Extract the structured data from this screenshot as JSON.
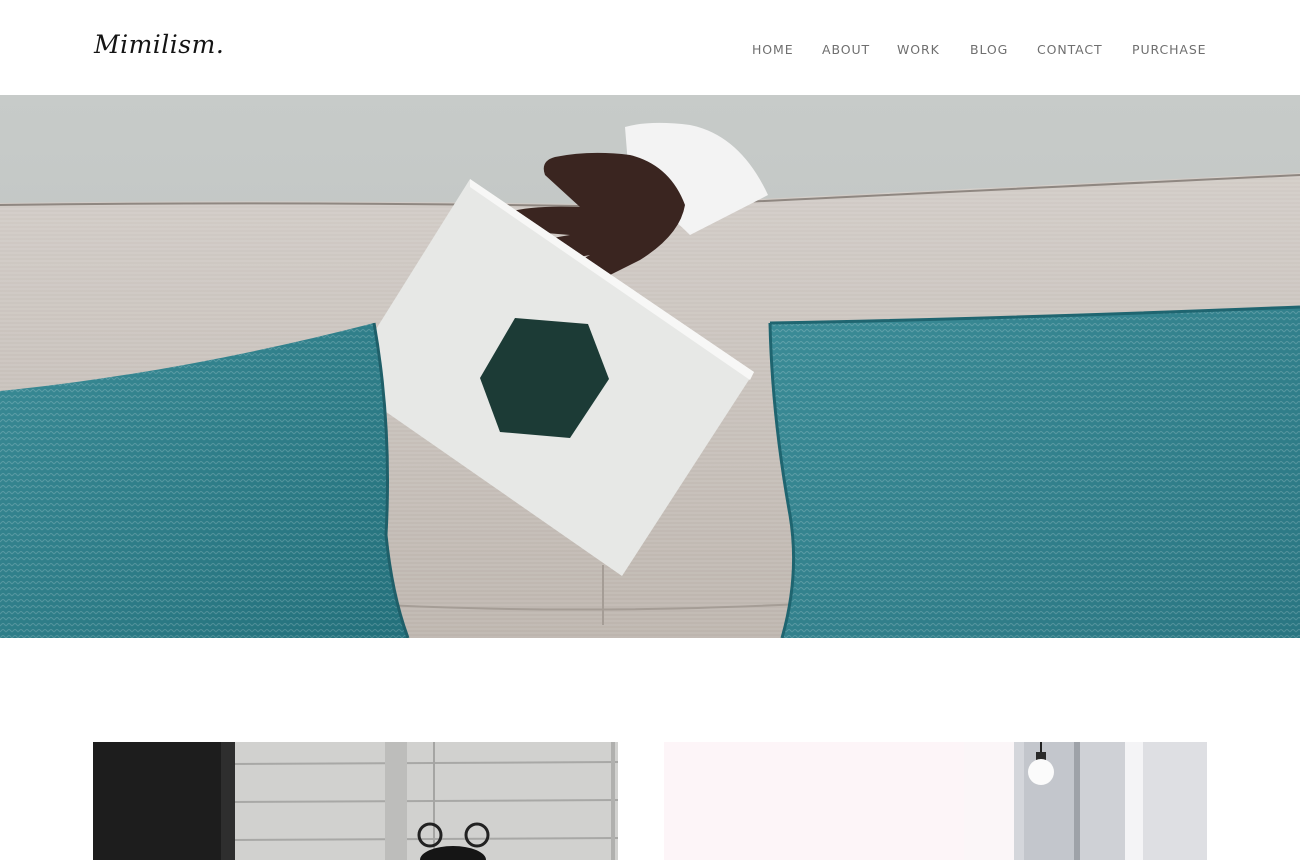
{
  "brand": {
    "logo_text": "Mimilism."
  },
  "nav": {
    "items": [
      {
        "label": "HOME"
      },
      {
        "label": "ABOUT"
      },
      {
        "label": "WORK"
      },
      {
        "label": "BLOG"
      },
      {
        "label": "CONTACT"
      },
      {
        "label": "PURCHASE"
      }
    ]
  },
  "hero": {
    "image": "photo-hand-holding-white-card-with-dark-green-hexagon-on-sofa-with-teal-cushions"
  },
  "gallery": {
    "items": [
      {
        "image": "photo-black-and-white-alarm-clock-against-wooden-wall"
      },
      {
        "image": "photo-bright-room-with-hanging-light-bulb-and-window"
      }
    ]
  },
  "colors": {
    "cushion": "#2f7f8a",
    "hexagon": "#1c3b36",
    "sofa": "#c9c2bc",
    "nav_text": "#6f6f6f"
  }
}
